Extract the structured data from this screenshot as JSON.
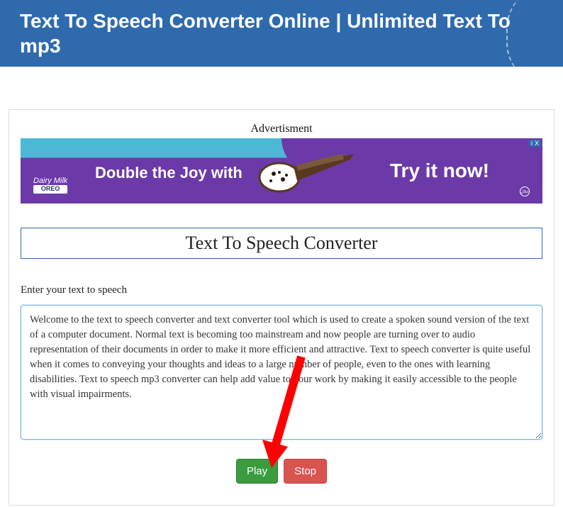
{
  "header": {
    "title": "Text To Speech Converter Online | Unlimited Text To mp3"
  },
  "ad": {
    "label": "Advertisment",
    "logo_top": "Dairy Milk",
    "logo_bottom": "OREO",
    "text_left": "Double the Joy with",
    "text_right": "Try it now!",
    "close_info": "i",
    "close_x": "X"
  },
  "tool": {
    "title": "Text To Speech Converter",
    "input_label": "Enter your text to speech",
    "text_value": "Welcome to the text to speech converter and text converter tool which is used to create a spoken sound version of the text of a computer document. Normal text is becoming too mainstream and now people are turning over to audio representation of their documents in order to make it more efficient and attractive. Text to speech converter is quite useful when it comes to conveying your thoughts and ideas to a large number of people, even to the ones with learning disabilities. Text to speech mp3 converter can help add value to your work by making it easily accessible to the people with visual impairments."
  },
  "buttons": {
    "play": "Play",
    "stop": "Stop"
  }
}
